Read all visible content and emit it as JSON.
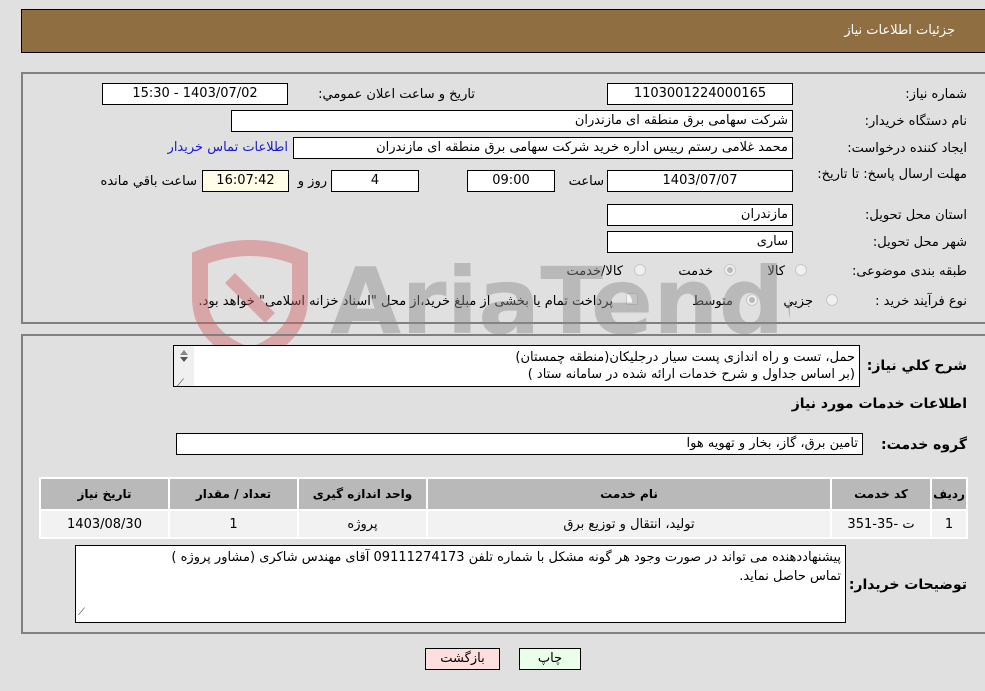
{
  "header": {
    "title": "جزئیات اطلاعات نیاز"
  },
  "form": {
    "need_number": {
      "label": "شماره نیاز:",
      "value": "1103001224000165"
    },
    "announce_datetime": {
      "label": "تاریخ و ساعت اعلان عمومي:",
      "value": "1403/07/02 - 15:30"
    },
    "buyer_org": {
      "label": "نام دستگاه خریدار:",
      "value": "شرکت سهامی برق منطقه ای مازندران"
    },
    "requester": {
      "label": "ایجاد کننده درخواست:",
      "value": "محمد غلامی رستم رییس اداره خرید شرکت سهامی برق منطقه ای مازندران"
    },
    "buyer_contact_link": "اطلاعات تماس خریدار",
    "deadline": {
      "label": "مهلت ارسال پاسخ: تا تاریخ:",
      "date": "1403/07/07",
      "time_label": "ساعت",
      "time": "09:00",
      "days": "4",
      "days_label": "روز و",
      "remaining": "16:07:42",
      "remaining_label": "ساعت باقي مانده"
    },
    "delivery_province": {
      "label": "استان محل تحویل:",
      "value": "مازندران"
    },
    "delivery_city": {
      "label": "شهر محل تحویل:",
      "value": "ساری"
    },
    "category": {
      "label": "طبقه بندی موضوعی:",
      "options": [
        "کالا",
        "خدمت",
        "کالا/خدمت"
      ],
      "selected": "خدمت"
    },
    "purchase_type": {
      "label": "نوع فرآیند خرید :",
      "options": [
        "جزيي",
        "متوسط"
      ],
      "selected": "متوسط",
      "treasury_note": "پرداخت تمام یا بخشی از مبلغ خرید،از محل \"اسناد خزانه اسلامی\" خواهد بود."
    }
  },
  "description": {
    "label": "شرح كلي نياز:",
    "lines": [
      "حمل، تست و راه اندازی پست سیار درجلیکان(منطقه چمستان)",
      "(بر اساس جداول و شرح خدمات ارائه شده در سامانه ستاد )"
    ]
  },
  "services": {
    "section_title": "اطلاعات خدمات مورد نياز",
    "group_label": "گروه خدمت:",
    "group_value": "تامین برق، گاز، بخار و تهویه هوا",
    "table": {
      "headers": [
        "ردیف",
        "کد خدمت",
        "نام خدمت",
        "واحد اندازه گیری",
        "تعداد / مقدار",
        "تاریخ نیاز"
      ],
      "rows": [
        [
          "1",
          "ت -35-351",
          "تولید، انتقال و توزیع برق",
          "پروژه",
          "1",
          "1403/08/30"
        ]
      ]
    }
  },
  "buyer_notes": {
    "label": "توضیحات خریدار:",
    "lines": [
      "پیشنهاددهنده می تواند در صورت وجود هر گونه مشکل با شماره تلفن 09111274173 آقای مهندس شاکری (مشاور پروژه )",
      "تماس حاصل نماید."
    ]
  },
  "buttons": {
    "print": "چاپ",
    "back": "بازگشت"
  },
  "watermark": {
    "text": "AriaTender.neT"
  },
  "colors": {
    "header_bg": "#8f6e42",
    "print_bg": "#eaffea",
    "back_bg": "#ffdede",
    "link": "#1a1acc"
  }
}
